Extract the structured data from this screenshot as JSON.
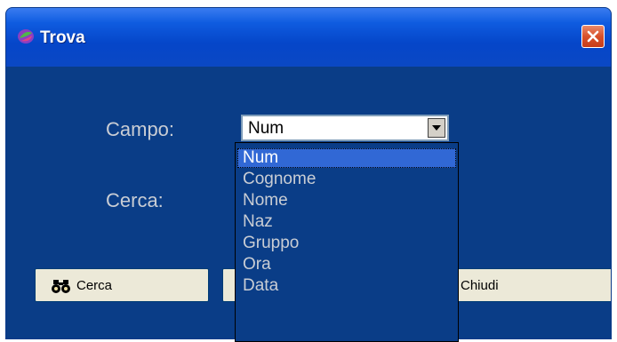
{
  "window": {
    "title": "Trova"
  },
  "form": {
    "campo_label": "Campo:",
    "cerca_label": "Cerca:",
    "campo_value": "Num"
  },
  "buttons": {
    "cerca": "Cerca",
    "chiudi": "Chiudi"
  },
  "dropdown": {
    "options": [
      "Num",
      "Cognome",
      "Nome",
      "Naz",
      "Gruppo",
      "Ora",
      "Data"
    ],
    "selected_index": 0
  },
  "colors": {
    "window_bg": "#0a3d87",
    "title_bar": "#0546c9",
    "selection": "#3168d5",
    "close_button": "#d8502a"
  },
  "icons": {
    "app": "app-icon",
    "close": "close-icon",
    "dropdown_arrow": "chevron-down-icon",
    "search": "binoculars-icon"
  }
}
